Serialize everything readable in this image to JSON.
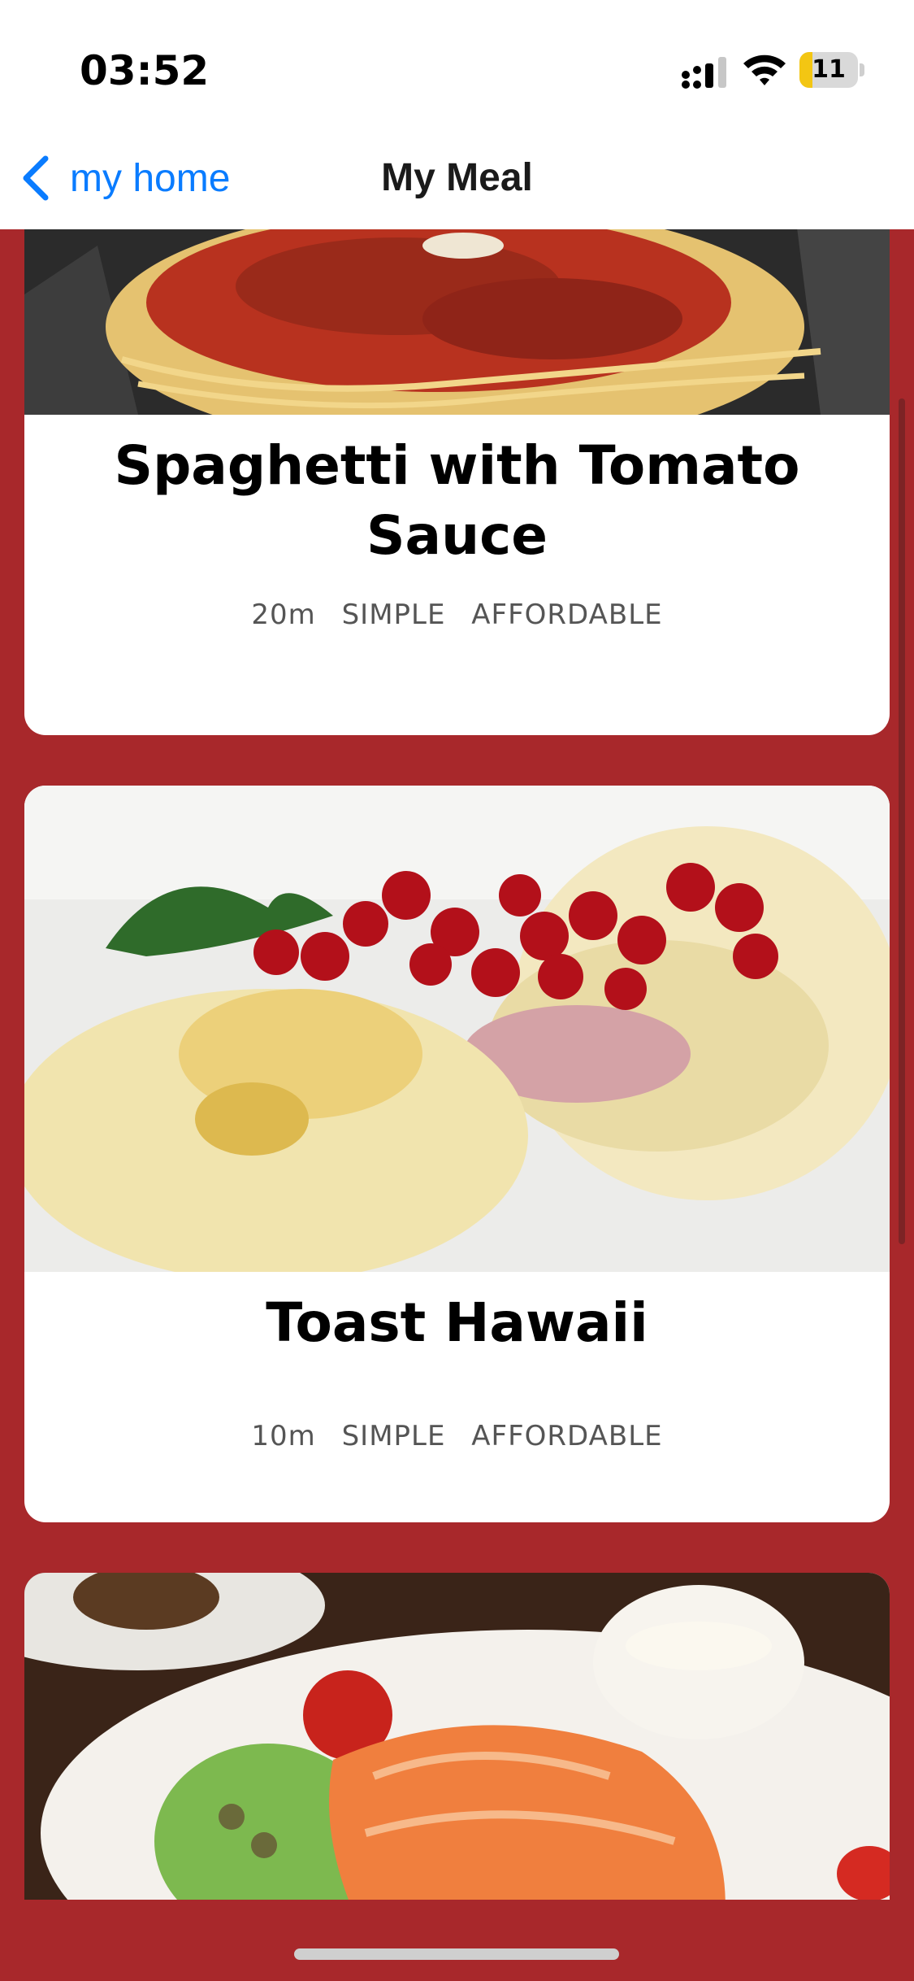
{
  "status_bar": {
    "time": "03:52",
    "battery": "11"
  },
  "nav": {
    "back_label": "my home",
    "title": "My Meal"
  },
  "meals": [
    {
      "title": "Spaghetti with Tomato Sauce",
      "duration": "20m",
      "complexity": "SIMPLE",
      "affordability": "AFFORDABLE"
    },
    {
      "title": "Toast Hawaii",
      "duration": "10m",
      "complexity": "SIMPLE",
      "affordability": "AFFORDABLE"
    }
  ],
  "colors": {
    "background": "#a8282b",
    "accent": "#0a7cff",
    "card": "#ffffff"
  }
}
